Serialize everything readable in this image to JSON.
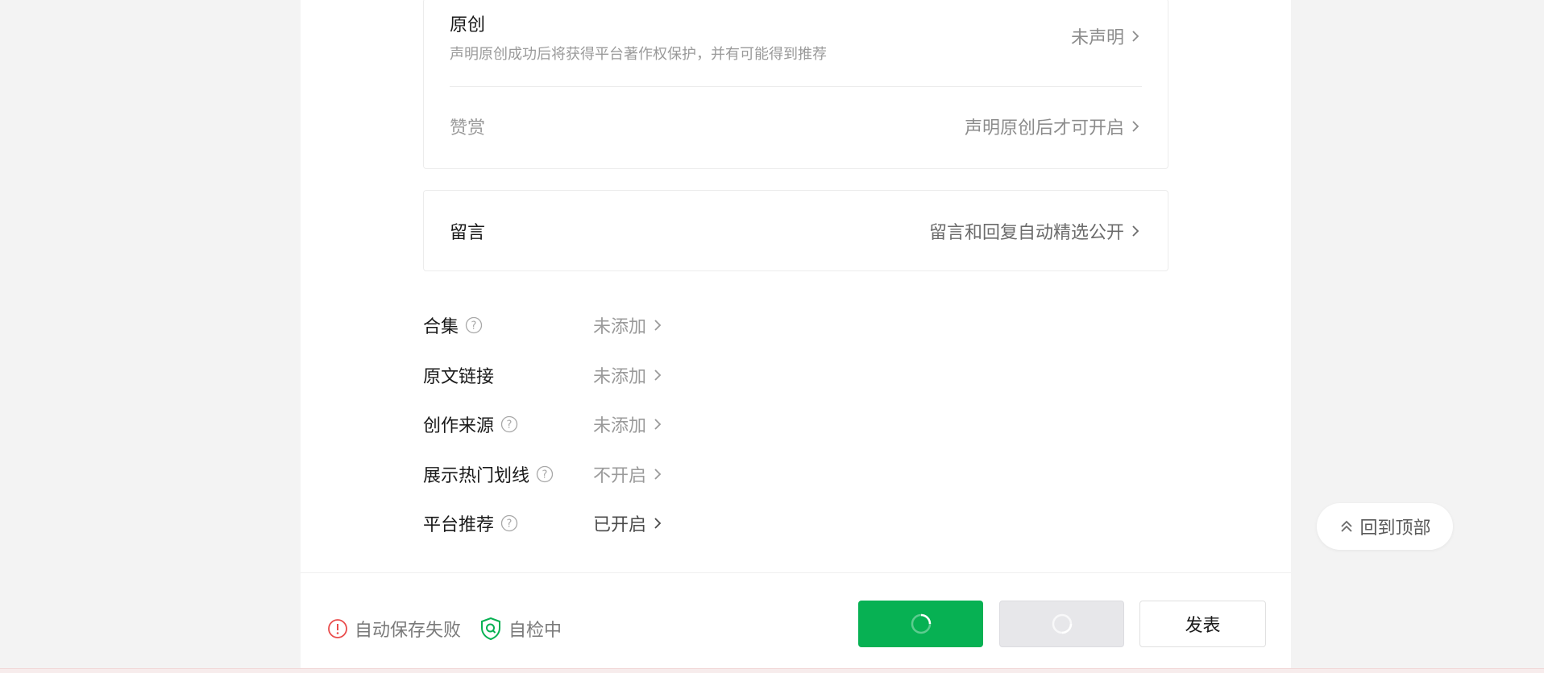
{
  "original_card": {
    "title": "原创",
    "description": "声明原创成功后将获得平台著作权保护，并有可能得到推荐",
    "value": "未声明",
    "reward_title": "赞赏",
    "reward_value": "声明原创后才可开启"
  },
  "comment_card": {
    "title": "留言",
    "value": "留言和回复自动精选公开"
  },
  "settings": [
    {
      "label": "合集",
      "value": "未添加",
      "has_help": true
    },
    {
      "label": "原文链接",
      "value": "未添加",
      "has_help": false
    },
    {
      "label": "创作来源",
      "value": "未添加",
      "has_help": true
    },
    {
      "label": "展示热门划线",
      "value": "不开启",
      "has_help": true
    },
    {
      "label": "平台推荐",
      "value": "已开启",
      "has_help": true
    }
  ],
  "footer": {
    "autosave_status": "自动保存失败",
    "check_status": "自检中",
    "publish_label": "发表"
  },
  "back_to_top": "回到顶部",
  "colors": {
    "accent_green": "#07b153",
    "error_red": "#e94b4b",
    "grey_button": "#e7e7ea"
  }
}
